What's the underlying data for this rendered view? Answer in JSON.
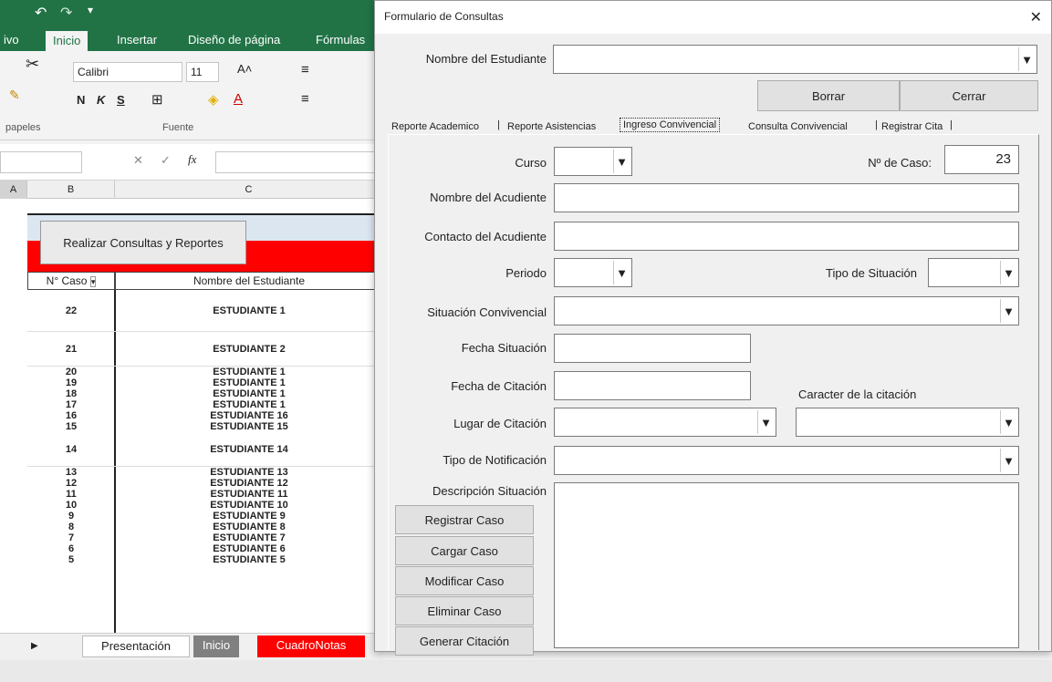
{
  "excel": {
    "ribbon_tabs": [
      "ivo",
      "Inicio",
      "Insertar",
      "Diseño de página",
      "Fórmulas"
    ],
    "font_name": "Calibri",
    "font_size": "11",
    "groups": [
      "papeles",
      "Fuente"
    ],
    "formula_fx": "fx",
    "columns": [
      "A",
      "B",
      "C"
    ],
    "sheet_button": "Realizar Consultas y Reportes",
    "table_headers": [
      "N° Caso",
      "Nombre del Estudiante"
    ],
    "rows": [
      {
        "caso": "22",
        "nombre": "ESTUDIANTE 1"
      },
      {
        "caso": "21",
        "nombre": "ESTUDIANTE 2"
      },
      {
        "caso": "20",
        "nombre": "ESTUDIANTE 1"
      },
      {
        "caso": "19",
        "nombre": "ESTUDIANTE 1"
      },
      {
        "caso": "18",
        "nombre": "ESTUDIANTE 1"
      },
      {
        "caso": "17",
        "nombre": "ESTUDIANTE 1"
      },
      {
        "caso": "16",
        "nombre": "ESTUDIANTE 16"
      },
      {
        "caso": "15",
        "nombre": "ESTUDIANTE 15"
      },
      {
        "caso": "14",
        "nombre": "ESTUDIANTE 14"
      },
      {
        "caso": "13",
        "nombre": "ESTUDIANTE 13"
      },
      {
        "caso": "12",
        "nombre": "ESTUDIANTE 12"
      },
      {
        "caso": "11",
        "nombre": "ESTUDIANTE 11"
      },
      {
        "caso": "10",
        "nombre": "ESTUDIANTE 10"
      },
      {
        "caso": "9",
        "nombre": "ESTUDIANTE 9"
      },
      {
        "caso": "8",
        "nombre": "ESTUDIANTE 8"
      },
      {
        "caso": "7",
        "nombre": "ESTUDIANTE 7"
      },
      {
        "caso": "6",
        "nombre": "ESTUDIANTE 6"
      },
      {
        "caso": "5",
        "nombre": "ESTUDIANTE 5"
      }
    ],
    "sheet_tabs": [
      "Presentación",
      "Inicio",
      "CuadroNotas"
    ]
  },
  "dialog": {
    "title": "Formulario de Consultas",
    "close": "✕",
    "student_label": "Nombre del Estudiante",
    "borrar": "Borrar",
    "cerrar": "Cerrar",
    "tabs": [
      "Reporte Academico",
      "Reporte Asistencias",
      "Ingreso Convivencial",
      "Consulta Convivencial",
      "Registrar Cita"
    ],
    "curso_label": "Curso",
    "caso_label": "Nº de Caso:",
    "caso_value": "23",
    "acudiente_label": "Nombre del Acudiente",
    "contacto_label": "Contacto del Acudiente",
    "periodo_label": "Periodo",
    "tipo_situacion_label": "Tipo de Situación",
    "situacion_label": "Situación Convivencial",
    "fecha_situacion_label": "Fecha Situación",
    "fecha_citacion_label": "Fecha de Citación",
    "caracter_label": "Caracter de la citación",
    "lugar_label": "Lugar de Citación",
    "notificacion_label": "Tipo de Notificación",
    "descripcion_label": "Descripción Situación",
    "buttons": [
      "Registrar Caso",
      "Cargar Caso",
      "Modificar Caso",
      "Eliminar Caso",
      "Generar Citación"
    ]
  }
}
